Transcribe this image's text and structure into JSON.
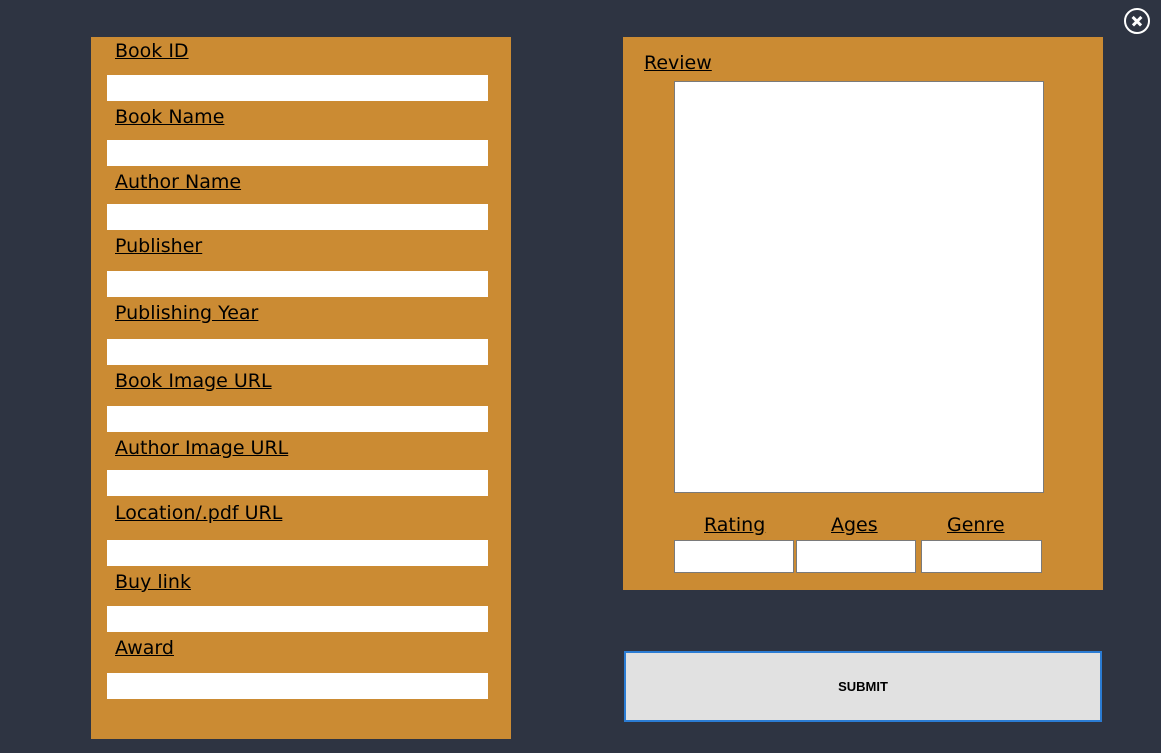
{
  "window": {
    "close_icon": "close-circle-icon"
  },
  "left_form": {
    "fields": [
      {
        "label": "Book ID",
        "value": ""
      },
      {
        "label": "Book Name",
        "value": ""
      },
      {
        "label": "Author Name",
        "value": ""
      },
      {
        "label": "Publisher",
        "value": ""
      },
      {
        "label": "Publishing Year",
        "value": ""
      },
      {
        "label": "Book Image URL",
        "value": ""
      },
      {
        "label": "Author Image URL",
        "value": ""
      },
      {
        "label": "Location/.pdf URL",
        "value": ""
      },
      {
        "label": "Buy link",
        "value": ""
      },
      {
        "label": "Award",
        "value": ""
      }
    ]
  },
  "right_form": {
    "review_label": "Review",
    "review_value": "",
    "rating_label": "Rating",
    "ages_label": "Ages",
    "genre_label": "Genre",
    "rating_value": "",
    "ages_value": "",
    "genre_value": ""
  },
  "submit_label": "SUBMIT",
  "colors": {
    "background": "#2e3442",
    "panel": "#cb8b33",
    "button_border": "#2b7cd3"
  }
}
